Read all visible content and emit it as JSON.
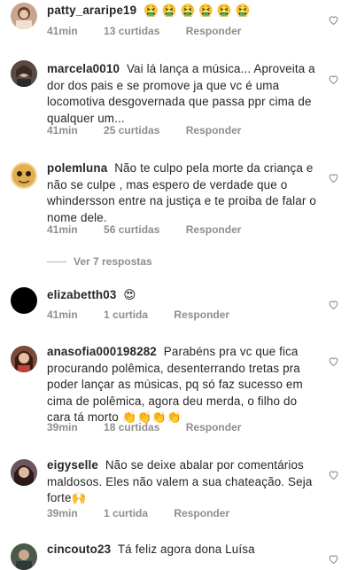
{
  "comments": [
    {
      "user": "patty_araripe19",
      "text": "🤮 🤮 🤮 🤮 🤮 🤮",
      "time": "41min",
      "likes": "13 curtidas",
      "reply": "Responder",
      "avatar_color": "#c8a58e"
    },
    {
      "user": "marcela0010",
      "text": "Vai lá lança a música... Aproveita a dor dos pais e se promove ja que vc é uma locomotiva desgovernada que passa ppr cima de qualquer um...",
      "time": "41min",
      "likes": "25 curtidas",
      "reply": "Responder",
      "avatar_color": "#5a4a44"
    },
    {
      "user": "polemluna",
      "text": "Não te culpo pela morte da criança e não se culpe ,  mas espero de verdade que o whindersson entre na justiça e te proiba de falar o nome dele.",
      "time": "41min",
      "likes": "56 curtidas",
      "reply": "Responder",
      "avatar_color": "#b88a3a"
    },
    {
      "user": "elizabetth03",
      "text": "😍",
      "time": "41min",
      "likes": "1 curtida",
      "reply": "Responder",
      "avatar_color": "#000000"
    },
    {
      "user": "anasofia000198282",
      "text": "Parabéns pra vc que fica procurando polêmica, desenterrando tretas pra poder lançar as músicas, pq só faz sucesso em cima de polêmica, agora deu merda, o filho do cara tá morto 👏👏👏👏",
      "time": "39min",
      "likes": "18 curtidas",
      "reply": "Responder",
      "avatar_color": "#7a4a3a"
    },
    {
      "user": "eigyselle",
      "text": "Não se deixe abalar por comentários maldosos. Eles não valem a sua chateação. Seja forte🙌",
      "time": "39min",
      "likes": "1 curtida",
      "reply": "Responder",
      "avatar_color": "#6b5560"
    },
    {
      "user": "cincouto23",
      "text": "Tá feliz agora dona Luísa",
      "time": "",
      "likes": "",
      "reply": "",
      "avatar_color": "#4a5a4a"
    }
  ],
  "view_replies": "Ver 7 respostas",
  "colors": {
    "meta": "#8e8e8e",
    "text": "#262626"
  }
}
